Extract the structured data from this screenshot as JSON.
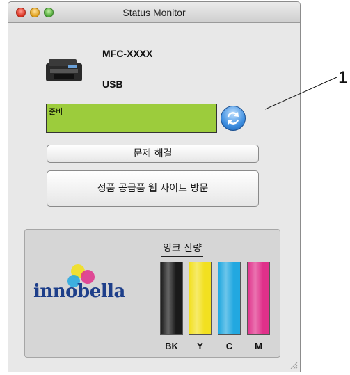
{
  "window": {
    "title": "Status Monitor"
  },
  "device": {
    "model": "MFC-XXXX",
    "connection": "USB",
    "icon": "printer-icon"
  },
  "status": {
    "text": "준비",
    "color": "#9ccc3c"
  },
  "buttons": {
    "troubleshoot": "문제 해결",
    "supplies": "정품 공급품 웹 사이트 방문",
    "refresh_icon": "refresh-icon"
  },
  "ink": {
    "title": "잉크 잔량",
    "logo_text": "innobella",
    "cartridges": [
      {
        "label": "BK",
        "color": "#1a1a1a",
        "level": 1.0
      },
      {
        "label": "Y",
        "color": "#f2e020",
        "level": 1.0
      },
      {
        "label": "C",
        "color": "#22a8e0",
        "level": 1.0
      },
      {
        "label": "M",
        "color": "#e0308a",
        "level": 1.0
      }
    ]
  },
  "callout": {
    "number": "1"
  }
}
